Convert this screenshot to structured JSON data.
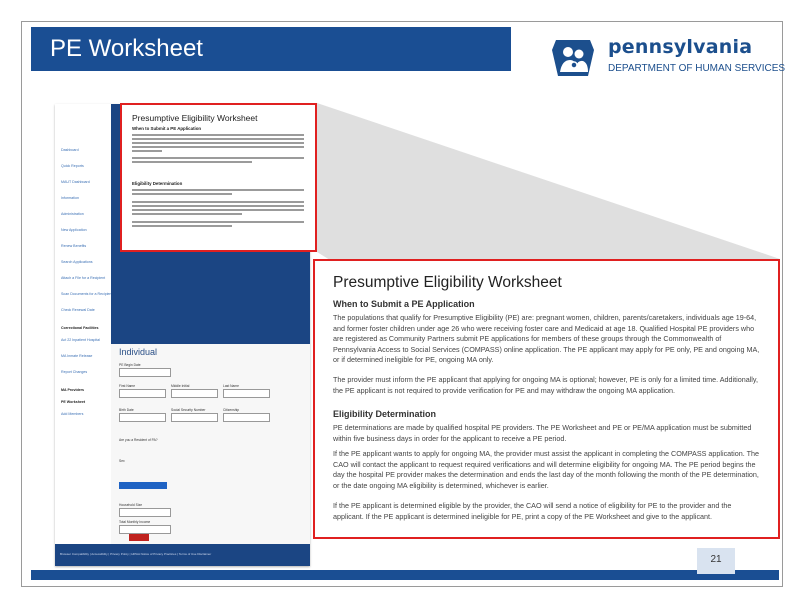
{
  "slide": {
    "title": "PE Worksheet",
    "page_number": "21"
  },
  "logo": {
    "word": "pennsylvania",
    "subtitle": "DEPARTMENT OF HUMAN SERVICES",
    "icon": "keystone-family-icon"
  },
  "screenshot": {
    "sidebar_items": [
      "Dashboard",
      "Quick Reports",
      "MAUT Dashboard",
      "Information",
      "Administration",
      "New Application",
      "Renew Benefits",
      "Search Applications",
      "Attach a File for a Recipient",
      "Scan Documents for a Recipient",
      "Check Renewal Date"
    ],
    "sidebar_section_1": "Correctional Facilities",
    "sidebar_section_1_items": [
      "Act 22 Inpatient Hospital",
      "MA Inmate Release",
      "Report Changes"
    ],
    "sidebar_section_2": "MA Providers",
    "sidebar_section_2_items": [
      "PE Worksheet",
      "Add Members"
    ],
    "form_heading": "Individual",
    "labels": {
      "pe_begin_date": "PE Begin Date",
      "first_name": "First Name",
      "middle_initial": "Middle Initial",
      "last_name": "Last Name",
      "birth_date": "Birth Date",
      "ssn": "Social Security Number",
      "citizenship": "Citizenship",
      "please_select": "Please Select",
      "resident_q": "Are you a Resident of PA?",
      "yes": "Yes",
      "no": "No",
      "sex": "Sex",
      "male": "Male",
      "female": "Female",
      "add_applicant": "Add Another Applicant",
      "household_size": "Household Size",
      "monthly_income": "Total Monthly Income",
      "allowable_income": "Allowable Income",
      "monthly_deductions": "Total Monthly Tax Deductions",
      "allowable_deductions": "Allowable Deductions",
      "submit": "Submit"
    },
    "footer": "Browser Compatibility  |  Accessibility  |  Privacy Policy  |  HIPAA Notice of Privacy Practices  |  Terms of Use Disclaimer",
    "small_box": {
      "title": "Presumptive Eligibility Worksheet",
      "heading_1": "When to Submit a PE Application",
      "heading_2": "Eligibility Determination"
    }
  },
  "zoom": {
    "title": "Presumptive Eligibility Worksheet",
    "heading_1": "When to Submit a PE Application",
    "para_1": "The populations that qualify for Presumptive Eligibility (PE) are: pregnant women, children, parents/caretakers, individuals age 19-64, and former foster children under age 26 who were receiving foster care and Medicaid at age 18. Qualified Hospital PE providers who are registered as Community Partners submit PE applications for members of these groups through the Commonwealth of Pennsylvania Access to Social Services (COMPASS) online application. The PE applicant may apply for PE only, PE and ongoing MA, or if determined ineligible for PE, ongoing MA only.",
    "para_2": "The provider must inform the PE applicant that applying for ongoing MA is optional; however, PE is only for a limited time. Additionally, the PE applicant is not required to provide verification for PE and may withdraw the ongoing MA application.",
    "heading_2": "Eligibility Determination",
    "para_3": "PE determinations are made by qualified hospital PE providers. The PE Worksheet and PE or PE/MA application must be submitted within five business days in order for the applicant to receive a PE period.",
    "para_4": "If the PE applicant wants to apply for ongoing MA, the provider must assist the applicant in completing the COMPASS application. The CAO will contact the applicant to request required verifications and will determine eligibility for ongoing MA. The PE period begins the day the hospital PE provider makes the determination and ends the last day of the month following the month of the PE determination, or the date ongoing MA eligibility is determined, whichever is earlier.",
    "para_5": "If the PE applicant is determined eligible by the provider, the CAO will send a notice of eligibility for PE to the provider and the applicant. If the PE applicant is determined ineligible for PE, print a copy of the PE Worksheet and give to the applicant."
  },
  "colors": {
    "navy": "#1a4e93",
    "highlight_red": "#e02020",
    "logo_blue": "#1c4f8d"
  }
}
